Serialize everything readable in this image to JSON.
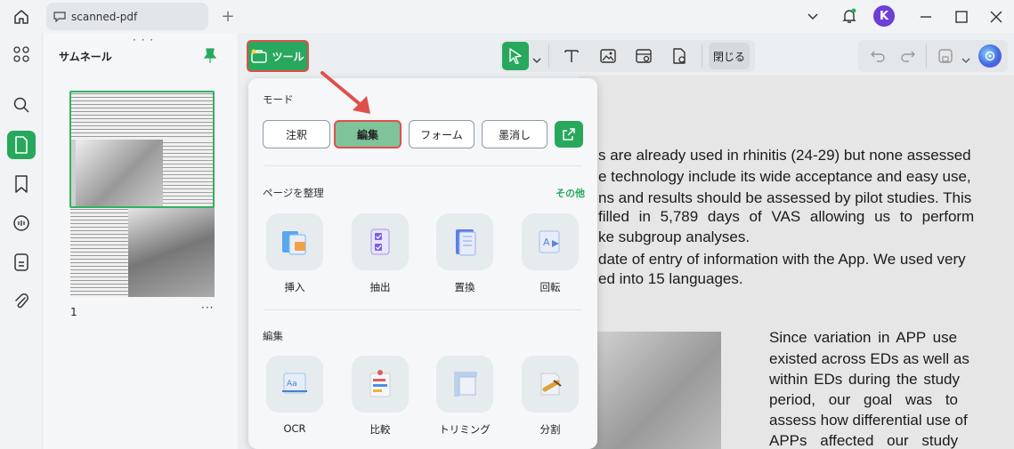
{
  "titlebar": {
    "tab_title": "scanned-pdf",
    "new_tab": "+",
    "avatar_letter": "K"
  },
  "thumbnails": {
    "title": "サムネール",
    "page_number": "1",
    "more": "···"
  },
  "toolbar": {
    "tool_label": "ツール",
    "close_label": "閉じる"
  },
  "tools_panel": {
    "mode_title": "モード",
    "modes": [
      "注釈",
      "編集",
      "フォーム",
      "墨消し"
    ],
    "organize_title": "ページを整理",
    "other_link": "その他",
    "organize_items": [
      "挿入",
      "抽出",
      "置換",
      "回転"
    ],
    "edit_title": "編集",
    "edit_items": [
      "OCR",
      "比較",
      "トリミング",
      "分割"
    ]
  },
  "document": {
    "lines_top": [
      "s are already used in rhinitis (24-29) but none assessed",
      "e technology include its wide acceptance and easy use,",
      "ns and results should be assessed by pilot studies. This",
      "filled in 5,789 days of VAS allowing us to perform",
      "ke subgroup analyses.",
      "date of entry of information with the App. We used very",
      "ed into 15 languages."
    ],
    "lines_right": [
      "Since variation in APP use",
      "existed across EDs as well as",
      "within EDs during the study",
      "period, our goal was to",
      "assess how differential use of",
      "APPs affected our study"
    ]
  },
  "colors": {
    "accent": "#27a85d",
    "highlight": "#e14f4a",
    "avatar": "#6c3fd6"
  }
}
